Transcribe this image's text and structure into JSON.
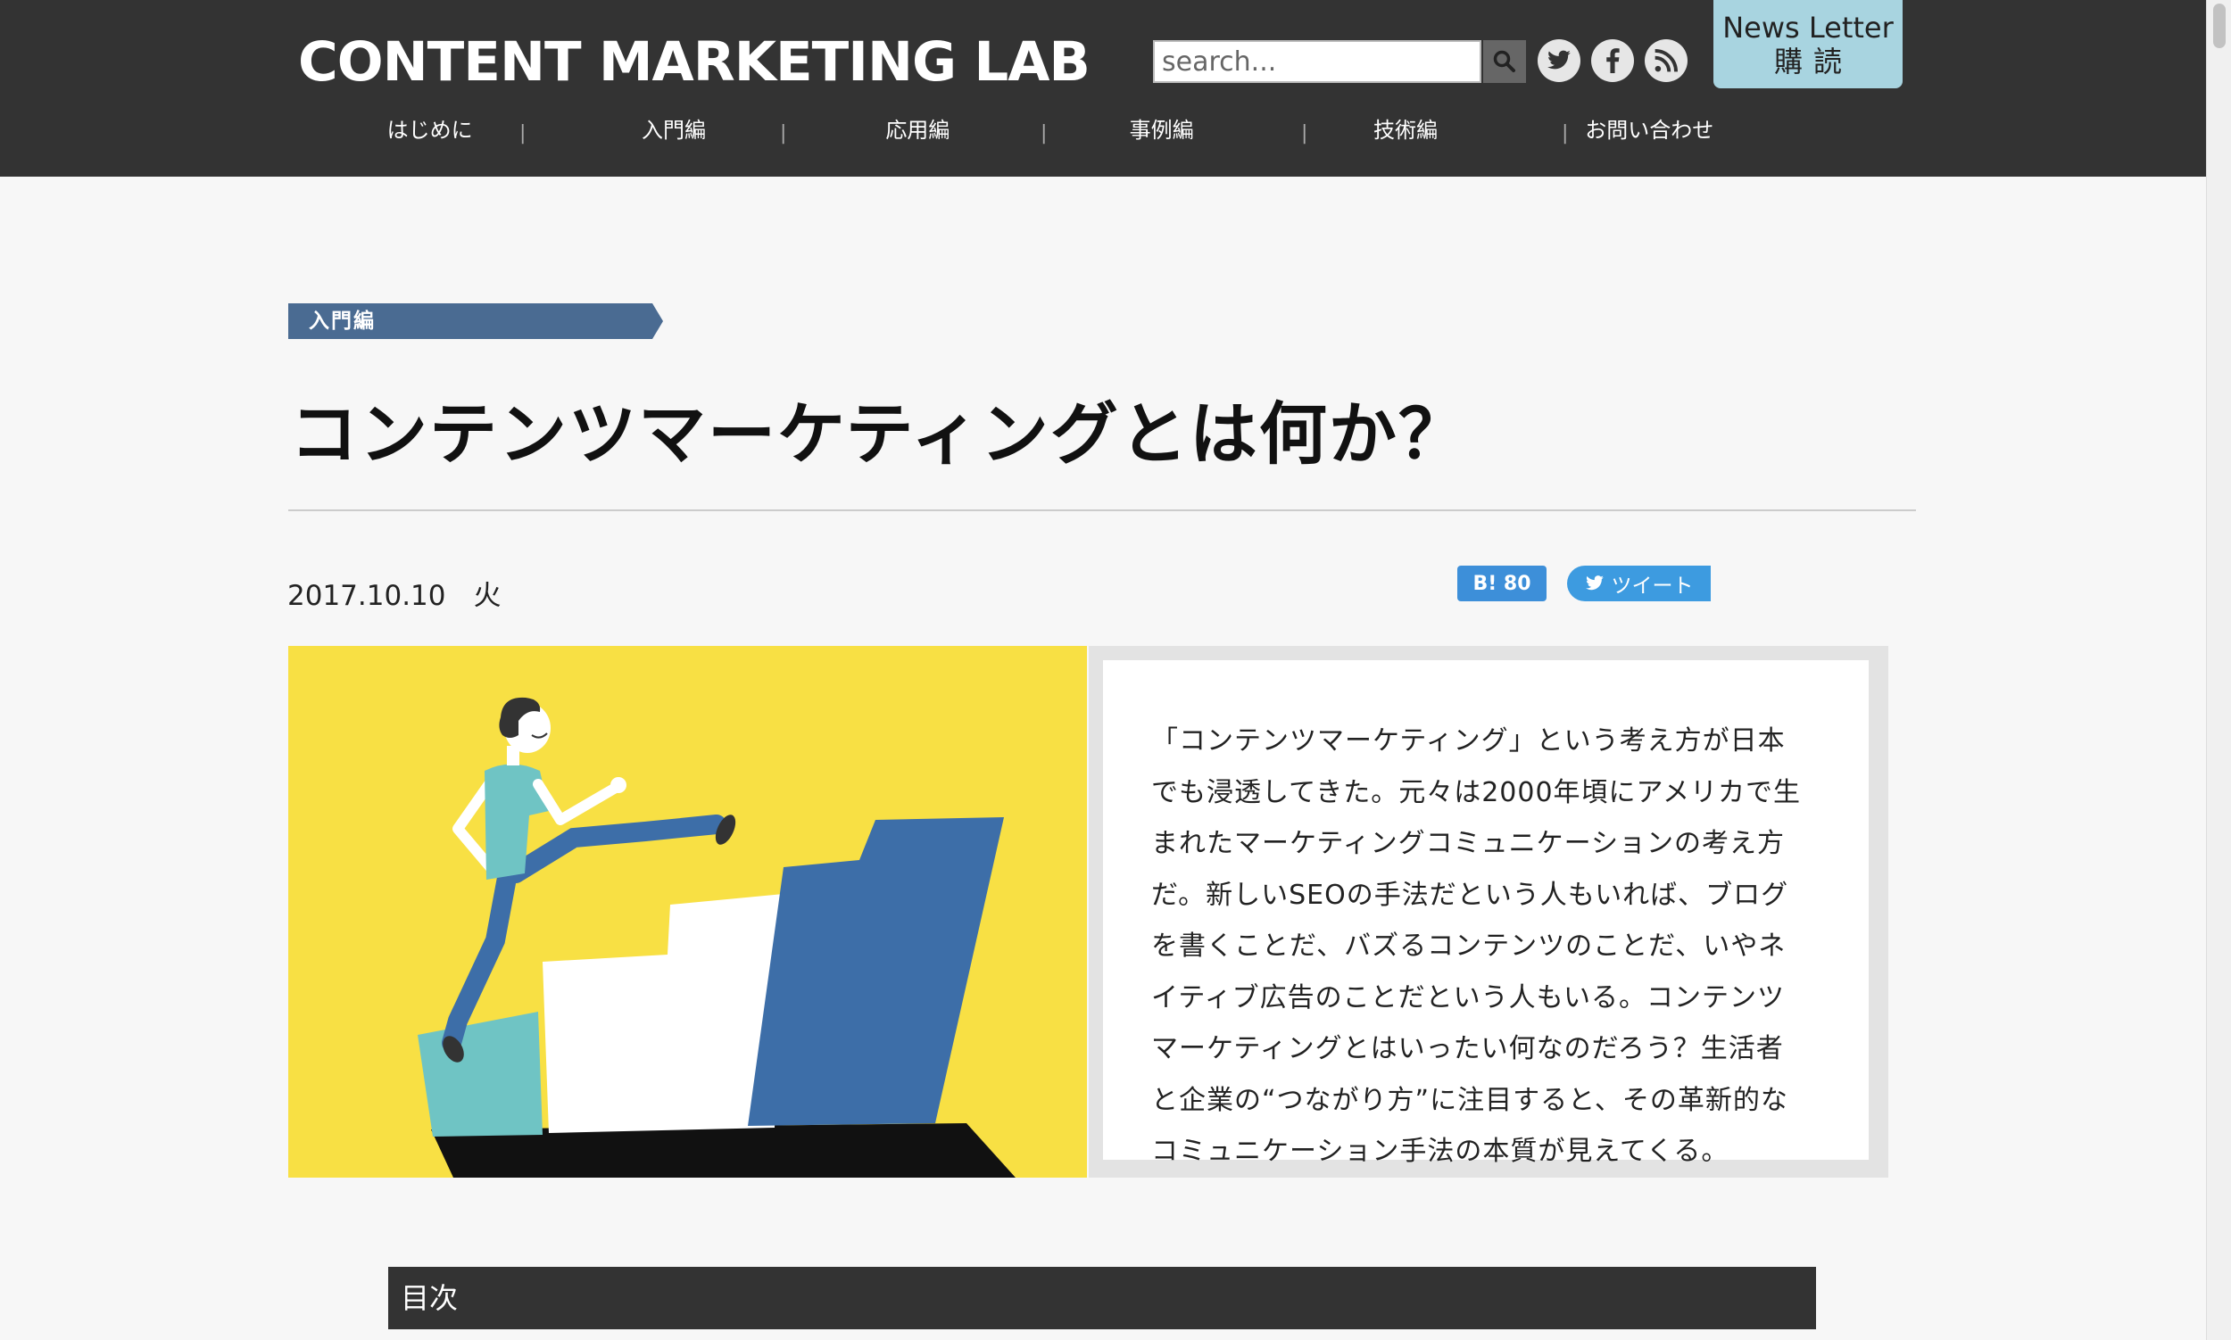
{
  "header": {
    "logo": "CONTENT MARKETING LAB",
    "search_placeholder": "search...",
    "newsletter_line1": "News Letter",
    "newsletter_line2": "購読"
  },
  "nav": {
    "items": [
      "はじめに",
      "入門編",
      "応用編",
      "事例編",
      "技術編",
      "お問い合わせ"
    ],
    "separator": "|"
  },
  "article": {
    "category": "入門編",
    "title": "コンテンツマーケティングとは何か？",
    "date": "2017.10.10　火",
    "hatena_label": "B! 80",
    "tweet_label": "ツイート",
    "lead_lines": [
      "「コンテンツマーケティング」という考え方が日本",
      "でも浸透してきた。元々は2000年頃にアメリカで生",
      "まれたマーケティングコミュニケーションの考え方",
      "だ。新しいSEOの手法だという人もいれば、ブログ",
      "を書くことだ、バズるコンテンツのことだ、いやネ",
      "イティブ広告のことだという人もいる。コンテンツ",
      "マーケティングとはいったい何なのだろう？生活者",
      "と企業の“つながり方”に注目すると、その革新的な",
      "コミュニケーション手法の本質が見えてくる。"
    ],
    "toc_label": "目次"
  },
  "colors": {
    "header_bg": "#333333",
    "category_tag": "#4a6b92",
    "hero_yellow": "#f8e044",
    "step_blue": "#3d6ea8",
    "step_teal": "#6fc4c4",
    "newsletter_bg": "#a8d4e0"
  }
}
